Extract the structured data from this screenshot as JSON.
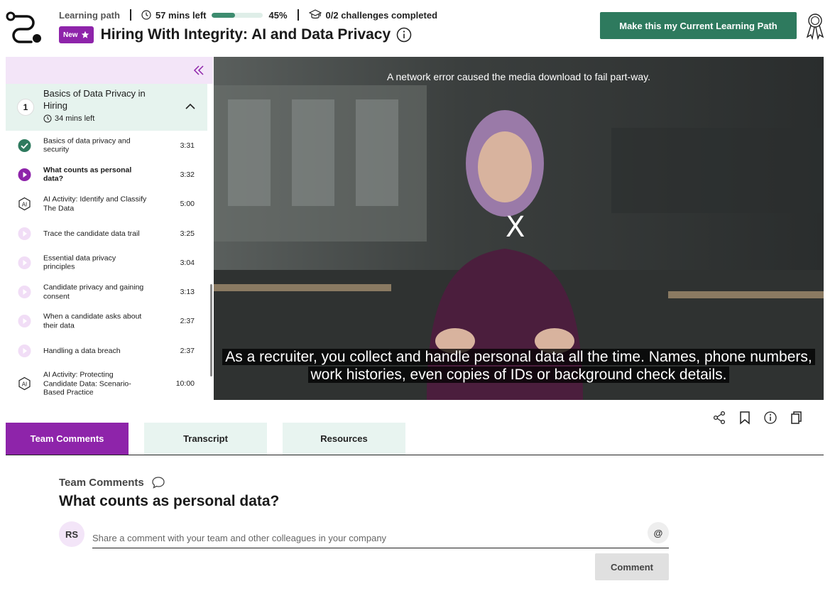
{
  "header": {
    "learning_path_label": "Learning path",
    "time_left": "57 mins left",
    "progress_percent": 45,
    "progress_label": "45%",
    "challenges": "0/2 challenges completed",
    "new_badge": "New",
    "title": "Hiring With Integrity: AI and Data Privacy",
    "cta_label": "Make this my Current Learning Path",
    "icons": [
      "path-logo-icon",
      "clock-icon",
      "graduation-cap-icon",
      "star-icon",
      "info-icon",
      "award-ribbon-icon"
    ]
  },
  "sidebar": {
    "section": {
      "number": "1",
      "title": "Basics of Data Privacy in Hiring",
      "time_left": "34 mins left"
    },
    "lessons": [
      {
        "label": "Basics of data privacy and security",
        "duration": "3:31",
        "status": "completed"
      },
      {
        "label": "What counts as personal data?",
        "duration": "3:32",
        "status": "active"
      },
      {
        "label": "AI Activity: Identify and Classify The Data",
        "duration": "5:00",
        "status": "ai"
      },
      {
        "label": "Trace the candidate data trail",
        "duration": "3:25",
        "status": "pending"
      },
      {
        "label": "Essential data privacy principles",
        "duration": "3:04",
        "status": "pending"
      },
      {
        "label": "Candidate privacy and gaining consent",
        "duration": "3:13",
        "status": "pending"
      },
      {
        "label": "When a candidate asks about their data",
        "duration": "2:37",
        "status": "pending"
      },
      {
        "label": "Handling a data breach",
        "duration": "2:37",
        "status": "pending"
      },
      {
        "label": "AI Activity: Protecting Candidate Data: Scenario-Based Practice",
        "duration": "10:00",
        "status": "ai"
      }
    ]
  },
  "video": {
    "error_message": "A network error caused the media download to fail part-way.",
    "close_label": "X",
    "caption": "As a recruiter, you collect and handle personal data all the time. Names, phone numbers, work histories, even copies of IDs or background check details."
  },
  "tools": [
    "share-icon",
    "bookmark-icon",
    "info-icon",
    "copy-icon"
  ],
  "tabs": [
    {
      "label": "Team Comments",
      "active": true
    },
    {
      "label": "Transcript",
      "active": false
    },
    {
      "label": "Resources",
      "active": false
    }
  ],
  "comments": {
    "heading": "Team Comments",
    "lesson_title": "What counts as personal data?",
    "avatar_initials": "RS",
    "placeholder": "Share a comment with your team and other colleagues in your company",
    "mention_label": "@",
    "submit_label": "Comment"
  },
  "colors": {
    "brand_green": "#2e7a5e",
    "brand_purple": "#8e24aa",
    "progress_fill": "#3d8c6f",
    "section_bg": "#e6f3ee",
    "sidebar_top_bg": "#f3e5f8"
  }
}
